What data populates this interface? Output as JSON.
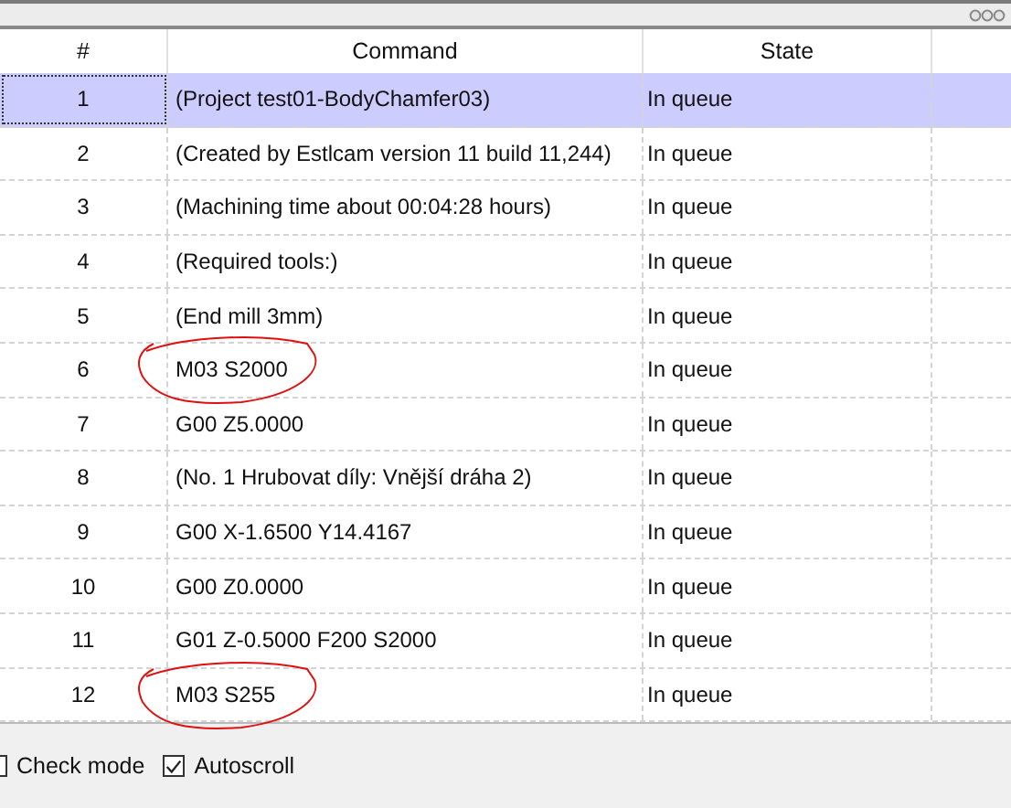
{
  "table": {
    "columns": [
      "#",
      "Command",
      "State"
    ],
    "rows": [
      {
        "num": "1",
        "command": "(Project test01-BodyChamfer03)",
        "state": "In queue",
        "selected": true,
        "circled": false
      },
      {
        "num": "2",
        "command": "(Created by Estlcam version 11 build 11,244)",
        "state": "In queue",
        "selected": false,
        "circled": false
      },
      {
        "num": "3",
        "command": "(Machining time about 00:04:28 hours)",
        "state": "In queue",
        "selected": false,
        "circled": false
      },
      {
        "num": "4",
        "command": "(Required tools:)",
        "state": "In queue",
        "selected": false,
        "circled": false
      },
      {
        "num": "5",
        "command": "(End mill 3mm)",
        "state": "In queue",
        "selected": false,
        "circled": false
      },
      {
        "num": "6",
        "command": "M03 S2000",
        "state": "In queue",
        "selected": false,
        "circled": true
      },
      {
        "num": "7",
        "command": "G00 Z5.0000",
        "state": "In queue",
        "selected": false,
        "circled": false
      },
      {
        "num": "8",
        "command": "(No. 1 Hrubovat díly: Vnější dráha 2)",
        "state": "In queue",
        "selected": false,
        "circled": false
      },
      {
        "num": "9",
        "command": "G00 X-1.6500 Y14.4167",
        "state": "In queue",
        "selected": false,
        "circled": false
      },
      {
        "num": "10",
        "command": "G00 Z0.0000",
        "state": "In queue",
        "selected": false,
        "circled": false
      },
      {
        "num": "11",
        "command": "G01 Z-0.5000 F200 S2000",
        "state": "In queue",
        "selected": false,
        "circled": false
      },
      {
        "num": "12",
        "command": "M03 S255",
        "state": "In queue",
        "selected": false,
        "circled": true
      }
    ]
  },
  "options": [
    {
      "label": "Check mode",
      "checked": false
    },
    {
      "label": "Autoscroll",
      "checked": true
    }
  ]
}
